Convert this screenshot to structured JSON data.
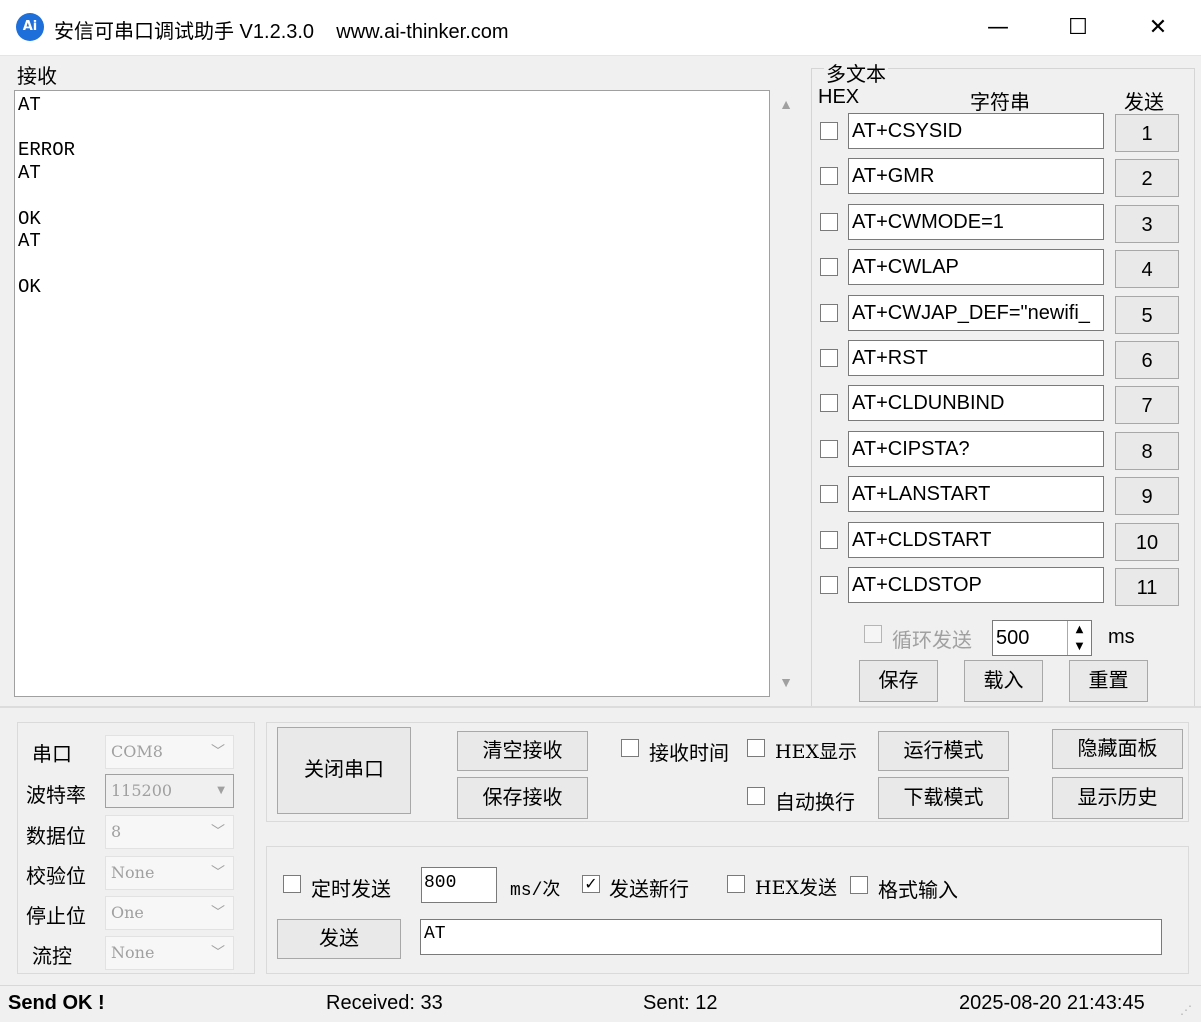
{
  "window": {
    "title": "安信可串口调试助手 V1.2.3.0    www.ai-thinker.com",
    "icon_text": "Ai",
    "minimize": "—",
    "maximize": "☐",
    "close": "✕"
  },
  "receive": {
    "label": "接收",
    "text": "AT\n\nERROR\nAT\n\nOK\nAT\n\nOK"
  },
  "multi": {
    "label": "多文本",
    "col_hex": "HEX",
    "col_string": "字符串",
    "col_send": "发送",
    "rows": [
      {
        "hex": false,
        "text": "AT+CSYSID",
        "send": "1"
      },
      {
        "hex": false,
        "text": "AT+GMR",
        "send": "2"
      },
      {
        "hex": false,
        "text": "AT+CWMODE=1",
        "send": "3"
      },
      {
        "hex": false,
        "text": "AT+CWLAP",
        "send": "4"
      },
      {
        "hex": false,
        "text": "AT+CWJAP_DEF=\"newifi_",
        "send": "5"
      },
      {
        "hex": false,
        "text": "AT+RST",
        "send": "6"
      },
      {
        "hex": false,
        "text": "AT+CLDUNBIND",
        "send": "7"
      },
      {
        "hex": false,
        "text": "AT+CIPSTA?",
        "send": "8"
      },
      {
        "hex": false,
        "text": "AT+LANSTART",
        "send": "9"
      },
      {
        "hex": false,
        "text": "AT+CLDSTART",
        "send": "10"
      },
      {
        "hex": false,
        "text": "AT+CLDSTOP",
        "send": "11"
      }
    ],
    "loop_label": "循环发送",
    "loop_interval": "500",
    "loop_unit": "ms",
    "save": "保存",
    "load": "载入",
    "reset": "重置"
  },
  "serial": {
    "port_label": "串口",
    "port_value": "COM8",
    "baud_label": "波特率",
    "baud_value": "115200",
    "data_label": "数据位",
    "data_value": "8",
    "parity_label": "校验位",
    "parity_value": "None",
    "stop_label": "停止位",
    "stop_value": "One",
    "flow_label": "流控",
    "flow_value": "None"
  },
  "controls": {
    "close_port": "关闭串口",
    "clear_recv": "清空接收",
    "save_recv": "保存接收",
    "recv_time": "接收时间",
    "hex_display": "HEX显示",
    "auto_wrap": "自动换行",
    "run_mode": "运行模式",
    "download_mode": "下载模式",
    "hide_panel": "隐藏面板",
    "show_history": "显示历史"
  },
  "send": {
    "timed_label": "定时发送",
    "timed_value": "800",
    "timed_unit": "ms/次",
    "newline_label": "发送新行",
    "newline_checked": true,
    "hex_send": "HEX发送",
    "format_input": "格式输入",
    "send_button": "发送",
    "input_value": "AT"
  },
  "status": {
    "message": "Send OK !",
    "received": "Received: 33",
    "sent": "Sent: 12",
    "time": "2025-08-20 21:43:45"
  }
}
